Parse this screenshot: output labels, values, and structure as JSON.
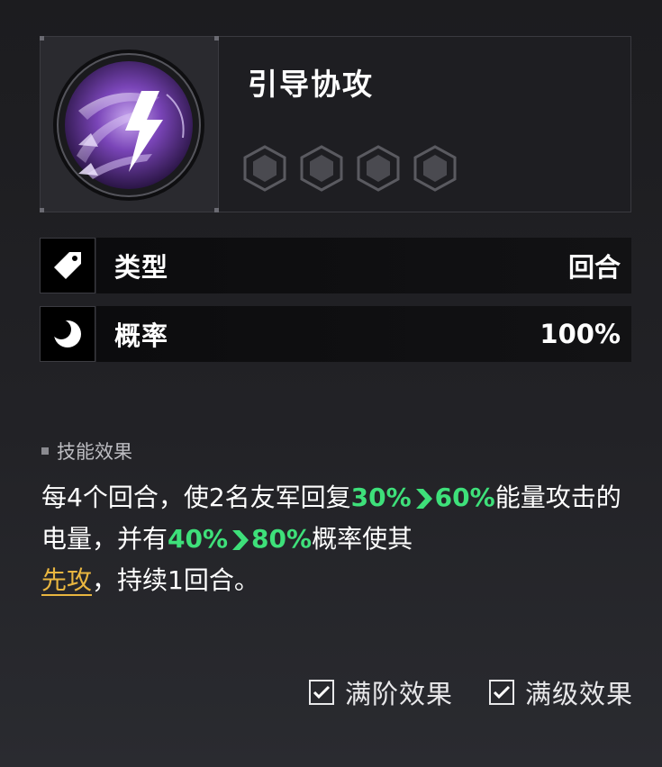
{
  "skill": {
    "name": "引导协攻",
    "level_slots": 4,
    "emblem_icon": "lightning-strike-icon",
    "accent_color": "#7a45b8"
  },
  "stats": [
    {
      "icon": "tag-icon",
      "label": "类型",
      "value": "回合"
    },
    {
      "icon": "crescent-moon-icon",
      "label": "概率",
      "value": "100%"
    }
  ],
  "effect": {
    "heading": "技能效果",
    "seg_1": "每4个回合，使2名友军回复",
    "val_1_from": "30%",
    "val_1_to": "60%",
    "seg_2": "能量攻击的电量，并有",
    "val_2_from": "40%",
    "val_2_to": "80%",
    "seg_3": "概率使其",
    "keyword": "先攻",
    "seg_4": "，持续1回合。",
    "highlight_color": "#3ee07a",
    "keyword_color": "#e9b640"
  },
  "toggles": [
    {
      "label": "满阶效果",
      "checked": true
    },
    {
      "label": "满级效果",
      "checked": true
    }
  ]
}
